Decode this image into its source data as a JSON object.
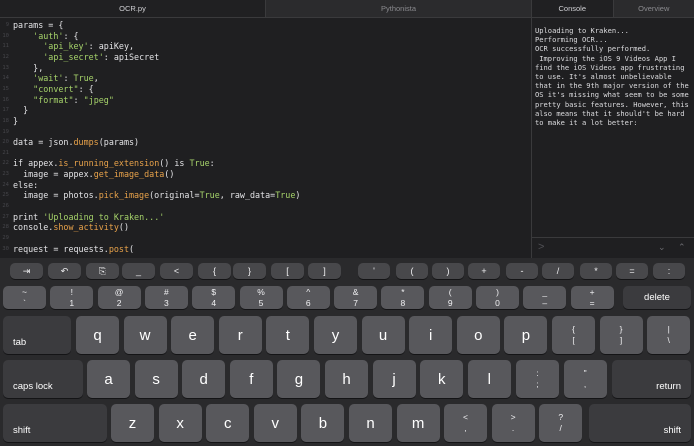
{
  "tabs_left": [
    "OCR.py",
    "Pythonista"
  ],
  "tabs_right": [
    "Console",
    "Overview"
  ],
  "code_lines": [
    {
      "n": "9",
      "parts": [
        {
          "t": "params = {",
          "c": ""
        }
      ]
    },
    {
      "n": "10",
      "parts": [
        {
          "t": "    ",
          "c": "g"
        },
        {
          "t": "'auth'",
          "c": "s"
        },
        {
          "t": ": {",
          "c": ""
        }
      ]
    },
    {
      "n": "11",
      "parts": [
        {
          "t": "      ",
          "c": "g"
        },
        {
          "t": "'api_key'",
          "c": "s"
        },
        {
          "t": ": apiKey,",
          "c": ""
        }
      ]
    },
    {
      "n": "12",
      "parts": [
        {
          "t": "      ",
          "c": "g"
        },
        {
          "t": "'api_secret'",
          "c": "s"
        },
        {
          "t": ": apiSecret",
          "c": ""
        }
      ]
    },
    {
      "n": "13",
      "parts": [
        {
          "t": "    },",
          "c": ""
        }
      ]
    },
    {
      "n": "14",
      "parts": [
        {
          "t": "    ",
          "c": "g"
        },
        {
          "t": "'wait'",
          "c": "s"
        },
        {
          "t": ": ",
          "c": ""
        },
        {
          "t": "True",
          "c": "k"
        },
        {
          "t": ",",
          "c": ""
        }
      ]
    },
    {
      "n": "15",
      "parts": [
        {
          "t": "    ",
          "c": ""
        },
        {
          "t": "\"convert\"",
          "c": "s"
        },
        {
          "t": ": {",
          "c": ""
        }
      ]
    },
    {
      "n": "16",
      "parts": [
        {
          "t": "    ",
          "c": "g"
        },
        {
          "t": "\"format\"",
          "c": "s"
        },
        {
          "t": ": ",
          "c": ""
        },
        {
          "t": "\"jpeg\"",
          "c": "s"
        }
      ]
    },
    {
      "n": "17",
      "parts": [
        {
          "t": "  }",
          "c": ""
        }
      ]
    },
    {
      "n": "18",
      "parts": [
        {
          "t": "}",
          "c": ""
        }
      ]
    },
    {
      "n": "19",
      "parts": [
        {
          "t": "",
          "c": ""
        }
      ]
    },
    {
      "n": "20",
      "parts": [
        {
          "t": "data = json.",
          "c": ""
        },
        {
          "t": "dumps",
          "c": "f"
        },
        {
          "t": "(params)",
          "c": ""
        }
      ]
    },
    {
      "n": "21",
      "parts": [
        {
          "t": "",
          "c": ""
        }
      ]
    },
    {
      "n": "22",
      "parts": [
        {
          "t": "if appex.",
          "c": ""
        },
        {
          "t": "is_running_extension",
          "c": "f"
        },
        {
          "t": "() is ",
          "c": ""
        },
        {
          "t": "True",
          "c": "k"
        },
        {
          "t": ":",
          "c": ""
        }
      ]
    },
    {
      "n": "23",
      "parts": [
        {
          "t": "  image = appex.",
          "c": ""
        },
        {
          "t": "get_image_data",
          "c": "f"
        },
        {
          "t": "()",
          "c": ""
        }
      ]
    },
    {
      "n": "24",
      "parts": [
        {
          "t": "else:",
          "c": ""
        }
      ]
    },
    {
      "n": "25",
      "parts": [
        {
          "t": "  image = photos.",
          "c": ""
        },
        {
          "t": "pick_image",
          "c": "f"
        },
        {
          "t": "(original=",
          "c": ""
        },
        {
          "t": "True",
          "c": "k"
        },
        {
          "t": ", raw_data=",
          "c": ""
        },
        {
          "t": "True",
          "c": "k"
        },
        {
          "t": ")",
          "c": ""
        }
      ]
    },
    {
      "n": "26",
      "parts": [
        {
          "t": "",
          "c": ""
        }
      ]
    },
    {
      "n": "27",
      "parts": [
        {
          "t": "print ",
          "c": ""
        },
        {
          "t": "'Uploading to Kraken...'",
          "c": "s"
        }
      ]
    },
    {
      "n": "28",
      "parts": [
        {
          "t": "console.",
          "c": ""
        },
        {
          "t": "show_activity",
          "c": "f"
        },
        {
          "t": "()",
          "c": ""
        }
      ]
    },
    {
      "n": "29",
      "parts": [
        {
          "t": "",
          "c": ""
        }
      ]
    },
    {
      "n": "30",
      "parts": [
        {
          "t": "request = requests.",
          "c": ""
        },
        {
          "t": "post",
          "c": "f"
        },
        {
          "t": "(",
          "c": ""
        }
      ]
    }
  ],
  "console_lines": [
    "Uploading to Kraken...",
    "Performing OCR...",
    "OCR successfully performed.",
    " Improving the iOS 9 Videos App I",
    "find the iOS Videos app frustrating",
    "to use. It's almost unbelievable",
    "that in the 9th major version of the",
    "OS it's missing what seem to be some",
    "pretty basic features. However, this",
    "also means that it should't be hard",
    "to make it a lot better:"
  ],
  "console_prompt": ">",
  "accessory_left": [
    "⇥",
    "↶",
    "⎘",
    "_",
    "<",
    "{",
    "}",
    "[",
    "]"
  ],
  "accessory_right": [
    "'",
    "(",
    ")",
    "+",
    "-",
    "/",
    "*",
    "=",
    ":"
  ],
  "number_row": [
    {
      "top": "~",
      "bot": "`"
    },
    {
      "top": "!",
      "bot": "1"
    },
    {
      "top": "@",
      "bot": "2"
    },
    {
      "top": "#",
      "bot": "3"
    },
    {
      "top": "$",
      "bot": "4"
    },
    {
      "top": "%",
      "bot": "5"
    },
    {
      "top": "^",
      "bot": "6"
    },
    {
      "top": "&",
      "bot": "7"
    },
    {
      "top": "*",
      "bot": "8"
    },
    {
      "top": "(",
      "bot": "9"
    },
    {
      "top": ")",
      "bot": "0"
    },
    {
      "top": "_",
      "bot": "–"
    },
    {
      "top": "+",
      "bot": "="
    }
  ],
  "row_q": [
    "q",
    "w",
    "e",
    "r",
    "t",
    "y",
    "u",
    "i",
    "o",
    "p"
  ],
  "row_q_extra": [
    {
      "top": "{",
      "bot": "["
    },
    {
      "top": "}",
      "bot": "]"
    },
    {
      "top": "|",
      "bot": "\\"
    }
  ],
  "row_a": [
    "a",
    "s",
    "d",
    "f",
    "g",
    "h",
    "j",
    "k",
    "l"
  ],
  "row_a_extra": [
    {
      "top": ":",
      "bot": ";"
    },
    {
      "top": "\"",
      "bot": ","
    }
  ],
  "row_z": [
    "z",
    "x",
    "c",
    "v",
    "b",
    "n",
    "m"
  ],
  "row_z_extra": [
    {
      "top": "<",
      "bot": ","
    },
    {
      "top": ">",
      "bot": "."
    },
    {
      "top": "?",
      "bot": "/"
    }
  ],
  "labels": {
    "delete": "delete",
    "tab": "tab",
    "caps": "caps lock",
    "return": "return",
    "shift_l": "shift",
    "shift_r": "shift"
  }
}
